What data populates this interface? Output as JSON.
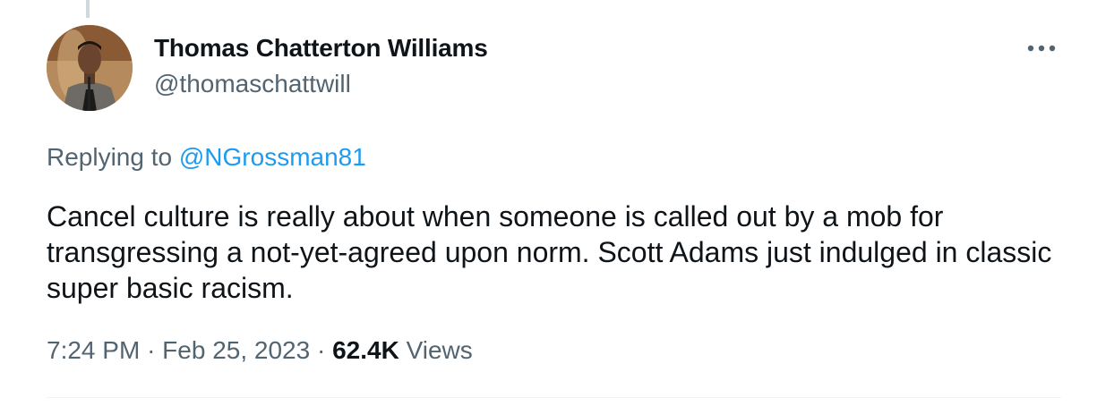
{
  "tweet": {
    "author": {
      "display_name": "Thomas Chatterton Williams",
      "handle": "@thomaschattwill"
    },
    "replying_prefix": "Replying to",
    "replying_to": "@NGrossman81",
    "text": "Cancel culture is really about when someone is called out by a mob for transgressing a not-yet-agreed upon norm. Scott Adams just indulged in classic super basic racism.",
    "time": "7:24 PM",
    "separator": "·",
    "date": "Feb 25, 2023",
    "views_count": "62.4K",
    "views_label": "Views"
  },
  "icons": {
    "more": "more-horizontal-icon"
  },
  "colors": {
    "text_primary": "#0f1419",
    "text_secondary": "#536471",
    "link": "#1d9bf0",
    "divider": "#eff3f4"
  }
}
